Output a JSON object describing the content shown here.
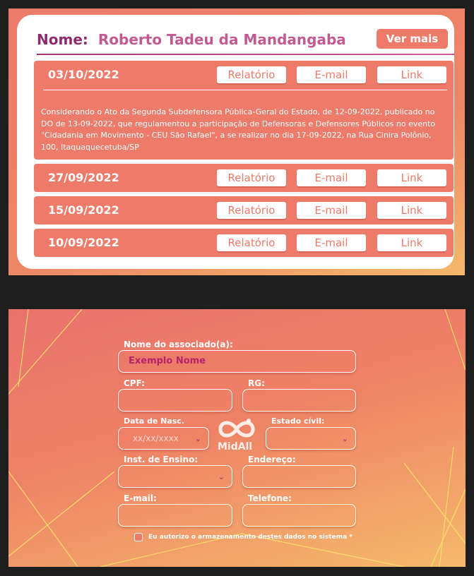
{
  "profile": {
    "name_label": "Nome:",
    "name_value": "Roberto Tadeu da Mandangaba",
    "ver_mais": "Ver mais"
  },
  "record_buttons": {
    "report": "Relatório",
    "email": "E-mail",
    "link": "Link"
  },
  "records": [
    {
      "date": "03/10/2022",
      "description": "Considerando o Ato da Segunda Subdefensora Pública-Geral do Estado, de 12-09-2022, publicado no DO de 13-09-2022, que regulamentou a participação de Defensoras e Defensores Públicos no evento \"Cidadania em Movimento - CEU São Rafael\", a se realizar no dia 17-09-2022, na Rua Cinira Polônio, 100, Itaquaquecetuba/SP"
    },
    {
      "date": "27/09/2022"
    },
    {
      "date": "15/09/2022"
    },
    {
      "date": "10/09/2022"
    }
  ],
  "form": {
    "nome_label": "Nome do associado(a):",
    "nome_value": "Exemplo Nome",
    "cpf_label": "CPF:",
    "rg_label": "RG:",
    "nasc_label": "Data de Nasc.",
    "nasc_placeholder": "xx/xx/xxxx",
    "estado_label": "Estado cívil:",
    "ensino_label": "Inst. de Ensino:",
    "endereco_label": "Endereço:",
    "email_label": "E-mail:",
    "telefone_label": "Telefone:",
    "consent": "Eu autorizo o armazenamento destes dados no sistema *"
  },
  "logo_text": "MidAll",
  "colors": {
    "accent": "#ee7b6a",
    "name_label": "#8e2b6e",
    "name_value": "#c25a92",
    "input_text": "#b5246b",
    "gradient_end": "#f5b96c"
  }
}
